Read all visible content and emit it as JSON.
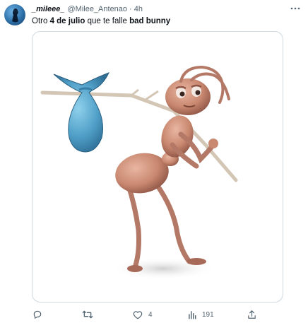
{
  "tweet": {
    "display_name": "_mileee_",
    "handle": "@Milee_Antenao",
    "separator": "·",
    "time": "4h",
    "text_prefix": "Otro ",
    "text_bold1": "4 de julio",
    "text_middle": " que te falle ",
    "text_bold2": "bad bunny"
  },
  "media": {
    "icon": "ant-with-bindle-illustration"
  },
  "actions": {
    "reply_count": "",
    "retweet_count": "",
    "like_count": "4",
    "views_count": "191"
  },
  "colors": {
    "text_primary": "#0f1419",
    "text_secondary": "#536471",
    "border": "#cfd9de",
    "ant": "#c98870",
    "bag": "#5aa8cf"
  }
}
